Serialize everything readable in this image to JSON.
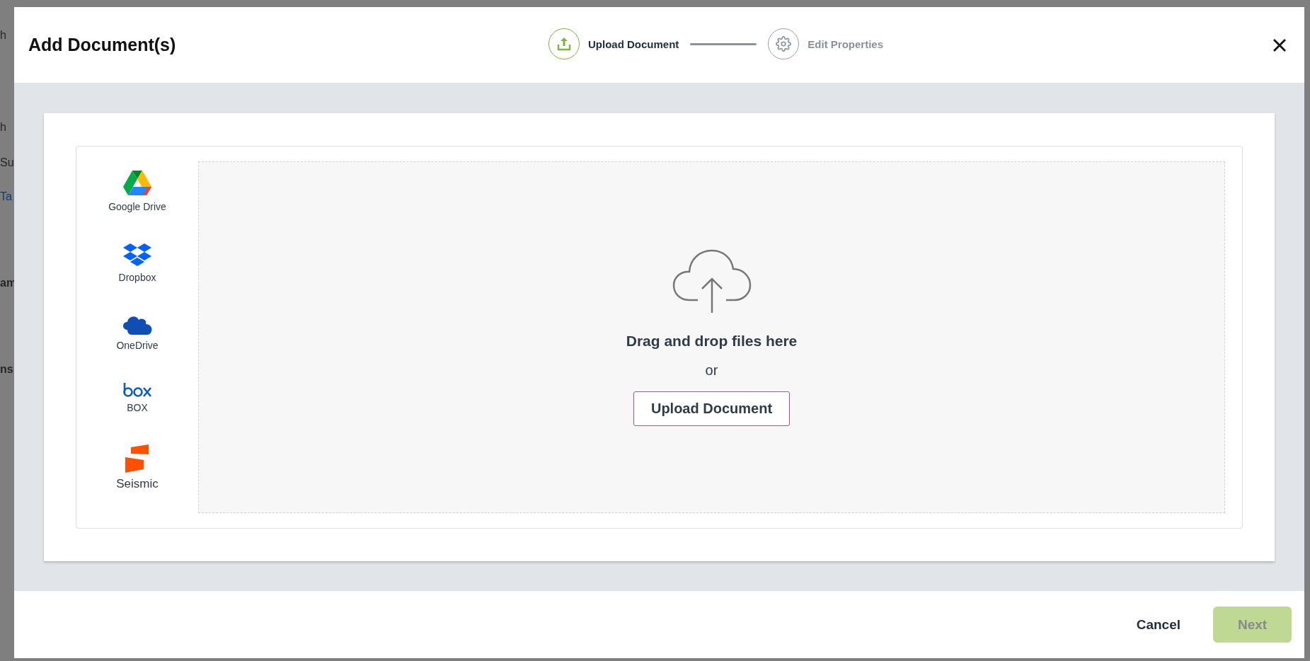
{
  "background": {
    "fragments": [
      {
        "text": "h",
        "kind": "plain"
      },
      {
        "text": "h",
        "kind": "plain"
      },
      {
        "text": "Su",
        "kind": "plain"
      },
      {
        "text": "Ta",
        "kind": "link"
      },
      {
        "text": "am",
        "kind": "bold"
      },
      {
        "text": "ns",
        "kind": "bold"
      }
    ]
  },
  "dialog": {
    "title": "Add Document(s)",
    "steps": [
      {
        "label": "Upload Document",
        "kind": "upload",
        "selected": true
      },
      {
        "label": "Edit Properties",
        "kind": "settings",
        "selected": false
      }
    ],
    "sources": [
      {
        "label": "Google Drive",
        "kind": "google-drive"
      },
      {
        "label": "Dropbox",
        "kind": "dropbox"
      },
      {
        "label": "OneDrive",
        "kind": "onedrive"
      },
      {
        "label": "BOX",
        "kind": "box"
      },
      {
        "label": "Seismic",
        "kind": "seismic"
      }
    ],
    "dropzone": {
      "prompt": "Drag and drop files here",
      "separator": "or",
      "button": "Upload Document"
    },
    "footer": {
      "cancel": "Cancel",
      "next": {
        "label": "Next",
        "disabled": true
      }
    }
  }
}
